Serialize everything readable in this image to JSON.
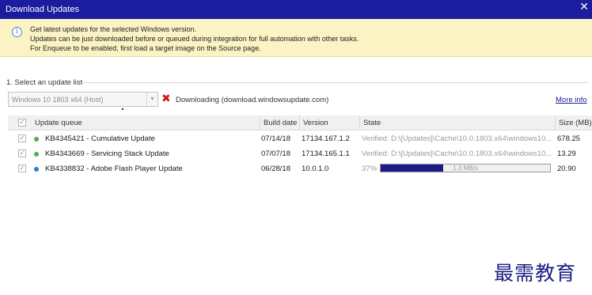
{
  "window": {
    "title": "Download Updates",
    "close_glyph": "✕"
  },
  "info": {
    "icon": "info-icon",
    "lines": [
      "Get latest updates for the selected Windows version.",
      "Updates can be just downloaded before or queued during integration for full automation with other tasks.",
      "For Enqueue to be enabled, first load a target image on the Source page."
    ]
  },
  "update_list": {
    "label": "1. Select an update list",
    "selected": "Windows 10 1803 x64 (Host)",
    "status_icon": "stop-x-icon",
    "status_text": "Downloading (download.windowsupdate.com)",
    "more_info": "More info"
  },
  "table": {
    "columns": {
      "queue": "Update queue",
      "build_date": "Build date",
      "version": "Version",
      "state": "State",
      "size": "Size (MB)"
    },
    "header_check": "✓",
    "rows": [
      {
        "check": "✓",
        "status_color": "#4caf50",
        "name": "KB4345421 - Cumulative Update",
        "build_date": "07/14/18",
        "version": "17134.167.1.2",
        "state": "Verified: D:\\[Updates]\\Cache\\10.0.1803.x64\\windows10...",
        "size": "678.25"
      },
      {
        "check": "✓",
        "status_color": "#4caf50",
        "name": "KB4343669 - Servicing Stack Update",
        "build_date": "07/07/18",
        "version": "17134.165.1.1",
        "state": "Verified: D:\\[Updates]\\Cache\\10.0.1803.x64\\windows10...",
        "size": "13.29"
      },
      {
        "check": "✓",
        "status_color": "#2a7fd4",
        "name": "KB4338832 - Adobe Flash Player Update",
        "build_date": "06/28/18",
        "version": "10.0.1.0",
        "state": "37%",
        "progress": 0.37,
        "speed": "1.3 MB/s",
        "size": "20.90"
      }
    ]
  },
  "watermark": "最需教育"
}
